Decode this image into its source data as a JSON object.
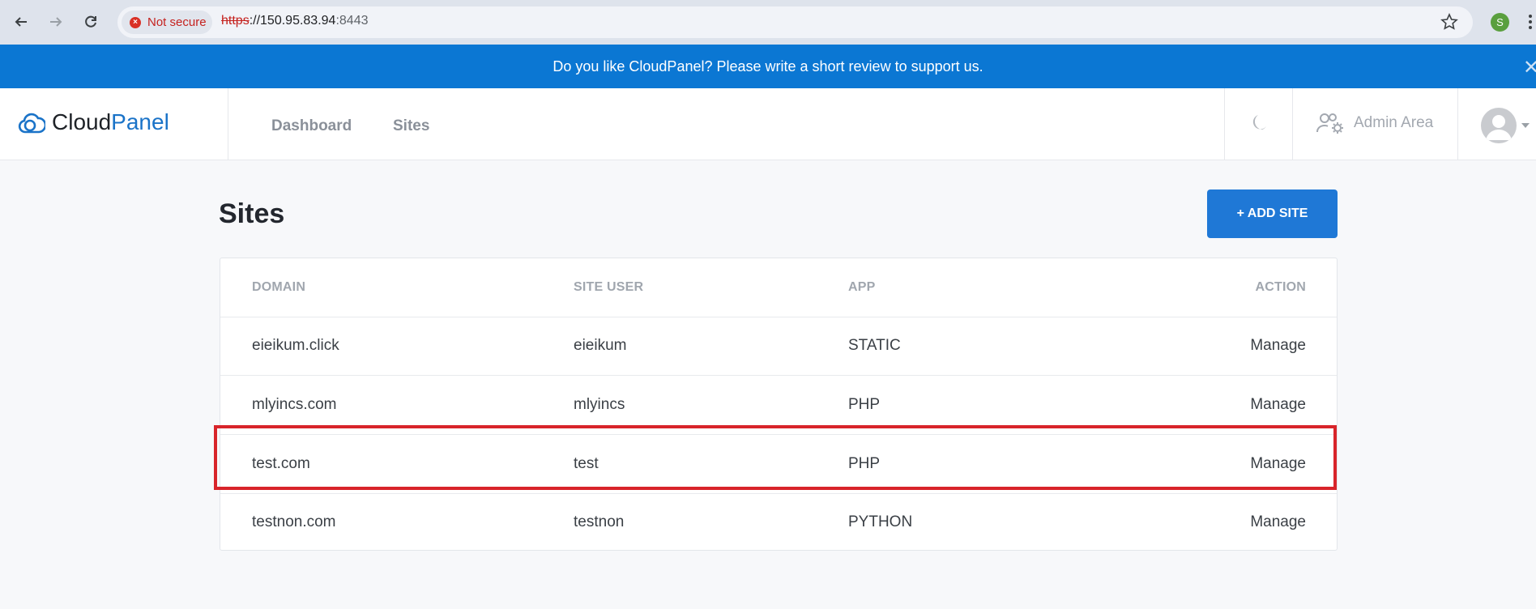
{
  "browser": {
    "security_label": "Not secure",
    "url_scheme": "https",
    "url_rest": "://150.95.83.94",
    "url_port": ":8443",
    "profile_initial": "S"
  },
  "banner": {
    "message": "Do you like CloudPanel? Please write a short review to support us."
  },
  "header": {
    "logo_part1": "Cloud",
    "logo_part2": "Panel",
    "nav": [
      "Dashboard",
      "Sites"
    ],
    "admin_label": "Admin Area"
  },
  "page": {
    "title": "Sites",
    "add_button": "+ ADD SITE"
  },
  "table": {
    "headers": [
      "DOMAIN",
      "SITE USER",
      "APP",
      "ACTION"
    ],
    "rows": [
      {
        "domain": "eieikum.click",
        "user": "eieikum",
        "app": "STATIC",
        "action": "Manage"
      },
      {
        "domain": "mlyincs.com",
        "user": "mlyincs",
        "app": "PHP",
        "action": "Manage"
      },
      {
        "domain": "test.com",
        "user": "test",
        "app": "PHP",
        "action": "Manage"
      },
      {
        "domain": "testnon.com",
        "user": "testnon",
        "app": "PYTHON",
        "action": "Manage"
      }
    ]
  },
  "colors": {
    "banner": "#0b77d3",
    "primary_button": "#1f78d6",
    "highlight": "#d8242a"
  }
}
